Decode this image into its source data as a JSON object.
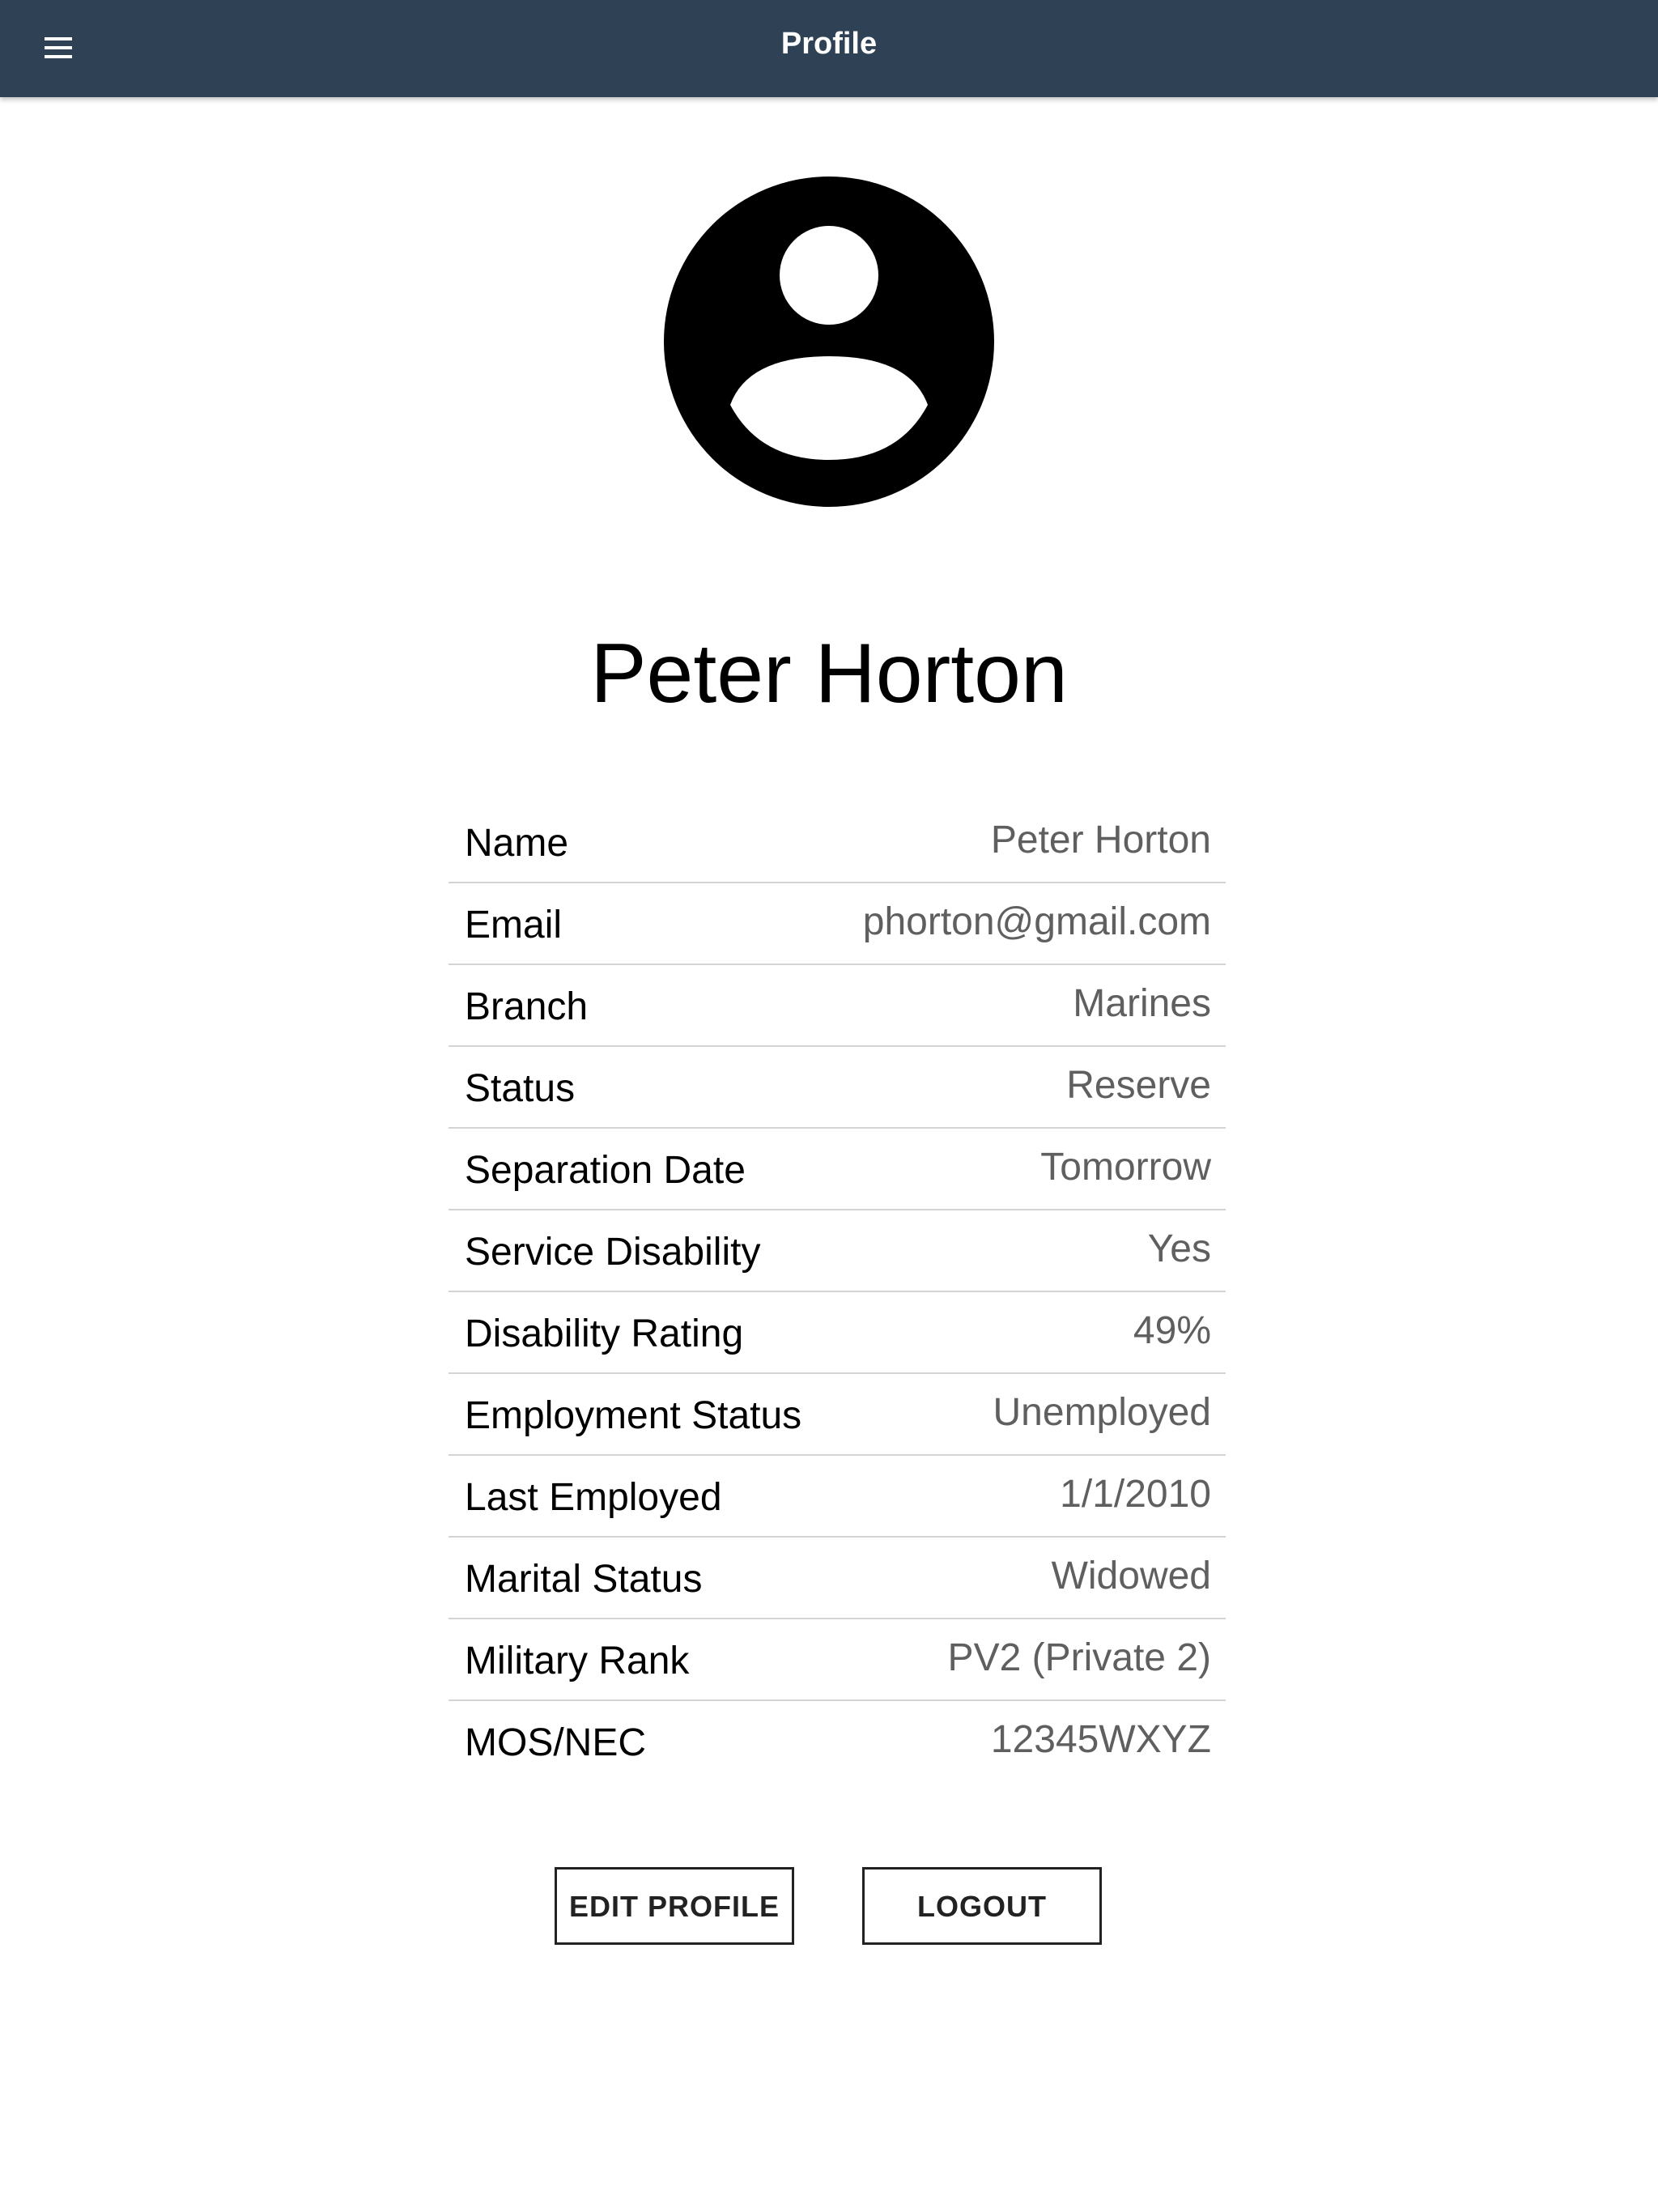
{
  "app_bar": {
    "title": "Profile",
    "menu_icon": "hamburger-menu-icon",
    "background_color": "#2e4155"
  },
  "avatar": {
    "icon": "account-circle-icon"
  },
  "profile": {
    "full_name": "Peter Horton",
    "fields": [
      {
        "label": "Name",
        "value": "Peter Horton"
      },
      {
        "label": "Email",
        "value": "phorton@gmail.com"
      },
      {
        "label": "Branch",
        "value": "Marines"
      },
      {
        "label": "Status",
        "value": "Reserve"
      },
      {
        "label": "Separation Date",
        "value": "Tomorrow"
      },
      {
        "label": "Service Disability",
        "value": "Yes"
      },
      {
        "label": "Disability Rating",
        "value": "49%"
      },
      {
        "label": "Employment Status",
        "value": "Unemployed"
      },
      {
        "label": "Last Employed",
        "value": "1/1/2010"
      },
      {
        "label": "Marital Status",
        "value": "Widowed"
      },
      {
        "label": "Military Rank",
        "value": "PV2 (Private 2)"
      },
      {
        "label": "MOS/NEC",
        "value": "12345WXYZ"
      }
    ]
  },
  "actions": {
    "edit_label": "EDIT PROFILE",
    "logout_label": "LOGOUT"
  }
}
